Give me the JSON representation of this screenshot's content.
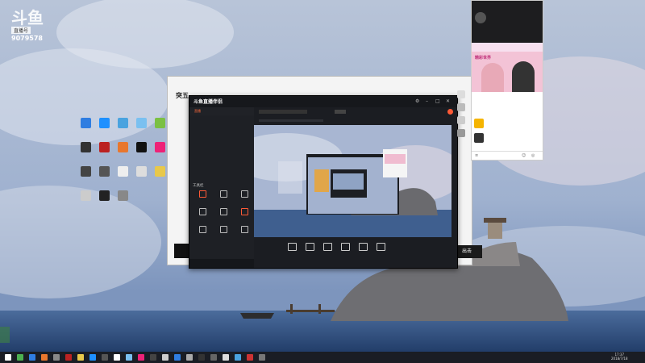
{
  "watermark": {
    "logo": "斗鱼",
    "sub": "直播号",
    "number": "9079578"
  },
  "desktop_icons": [
    {
      "label": "",
      "color": "#2f7de1"
    },
    {
      "label": "",
      "color": "#1e90ff"
    },
    {
      "label": "",
      "color": "#4aa3df"
    },
    {
      "label": "",
      "color": "#7ac0f0"
    },
    {
      "label": "",
      "color": "#7bc043"
    },
    {
      "label": "",
      "color": "#333"
    },
    {
      "label": "",
      "color": "#b22"
    },
    {
      "label": "",
      "color": "#e8772e"
    },
    {
      "label": "",
      "color": "#111"
    },
    {
      "label": "",
      "color": "#e27"
    },
    {
      "label": "",
      "color": "#444"
    },
    {
      "label": "",
      "color": "#555"
    },
    {
      "label": "",
      "color": "#eee"
    },
    {
      "label": "",
      "color": "#ddd"
    },
    {
      "label": "",
      "color": "#e8c84a"
    },
    {
      "label": "",
      "color": "#ccc"
    },
    {
      "label": "",
      "color": "#222"
    },
    {
      "label": "",
      "color": "#888"
    }
  ],
  "back_window": {
    "title": "",
    "header": "突五",
    "exit_label": "出击"
  },
  "app": {
    "brand": "斗鱼直播伴侣",
    "version": "",
    "tabs": [
      "直播",
      "",
      ""
    ],
    "sidebar_rows": [
      "",
      "",
      "",
      "",
      "",
      "",
      "",
      ""
    ],
    "tools_title": "工具栏",
    "tools": [
      {
        "label": "",
        "red": true
      },
      {
        "label": "",
        "red": false
      },
      {
        "label": "",
        "red": false
      },
      {
        "label": "",
        "red": false
      },
      {
        "label": "",
        "red": false
      },
      {
        "label": "",
        "red": true
      },
      {
        "label": "",
        "red": false
      },
      {
        "label": "",
        "red": false
      },
      {
        "label": "",
        "red": false
      }
    ],
    "sidebar_footer": "",
    "bottom_buttons": [
      "",
      "",
      "",
      "",
      "",
      ""
    ]
  },
  "chat": {
    "streamer": "",
    "banner": "精彩世界",
    "list": [
      "",
      "",
      ""
    ],
    "items": [
      {
        "title": ""
      },
      {
        "title": ""
      }
    ]
  },
  "taskbar": {
    "time": "17:37",
    "date": "2018/7/18"
  }
}
